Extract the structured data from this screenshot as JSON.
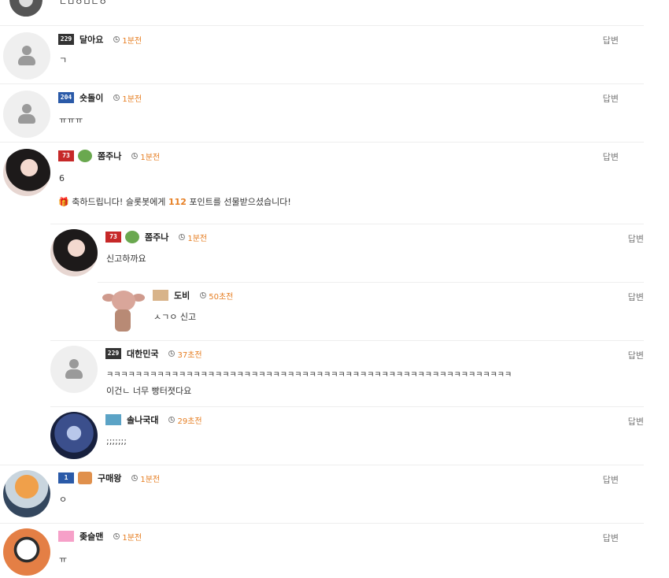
{
  "top_text": "ㄴㅁㅇㅁㄴㅇ",
  "reply_label": "답변",
  "comments": [
    {
      "level": "229",
      "nick": "달아요",
      "time": "1분전",
      "text": "ㄱ"
    },
    {
      "level": "204",
      "nick": "숏돌이",
      "time": "1분전",
      "text": "ㅠㅠㅠ"
    },
    {
      "level": "73",
      "nick": "쫌주나",
      "time": "1분전",
      "text": "6",
      "gift_prefix": "축하드립니다! 슬롯봇에게 ",
      "gift_points": "112",
      "gift_suffix": " 포인트를 선물받으셨습니다!"
    },
    {
      "level": "73",
      "nick": "쫌주나",
      "time": "1분전",
      "text": "신고하까요"
    },
    {
      "level": "",
      "nick": "도비",
      "time": "50초전",
      "text": "ㅅㄱㅇ 신고"
    },
    {
      "level": "229",
      "nick": "대한민국",
      "time": "37초전",
      "text": "ㅋㅋㅋㅋㅋㅋㅋㅋㅋㅋㅋㅋㅋㅋㅋㅋㅋㅋㅋㅋㅋㅋㅋㅋㅋㅋㅋㅋㅋㅋㅋㅋㅋㅋㅋㅋㅋㅋㅋㅋㅋㅋㅋㅋㅋㅋㅋㅋㅋㅋㅋㅋㅋㅋㅋㅋ",
      "text2": "이건ㄴ 너무 빵터졋다요"
    },
    {
      "level": "",
      "nick": "솔나국대",
      "time": "29초전",
      "text": ";;;;;;;"
    },
    {
      "level": "1",
      "nick": "구매왕",
      "time": "1분전",
      "text": "ㅇ"
    },
    {
      "level": "",
      "nick": "좆슬맨",
      "time": "1분전",
      "text": "ㅠ"
    }
  ]
}
